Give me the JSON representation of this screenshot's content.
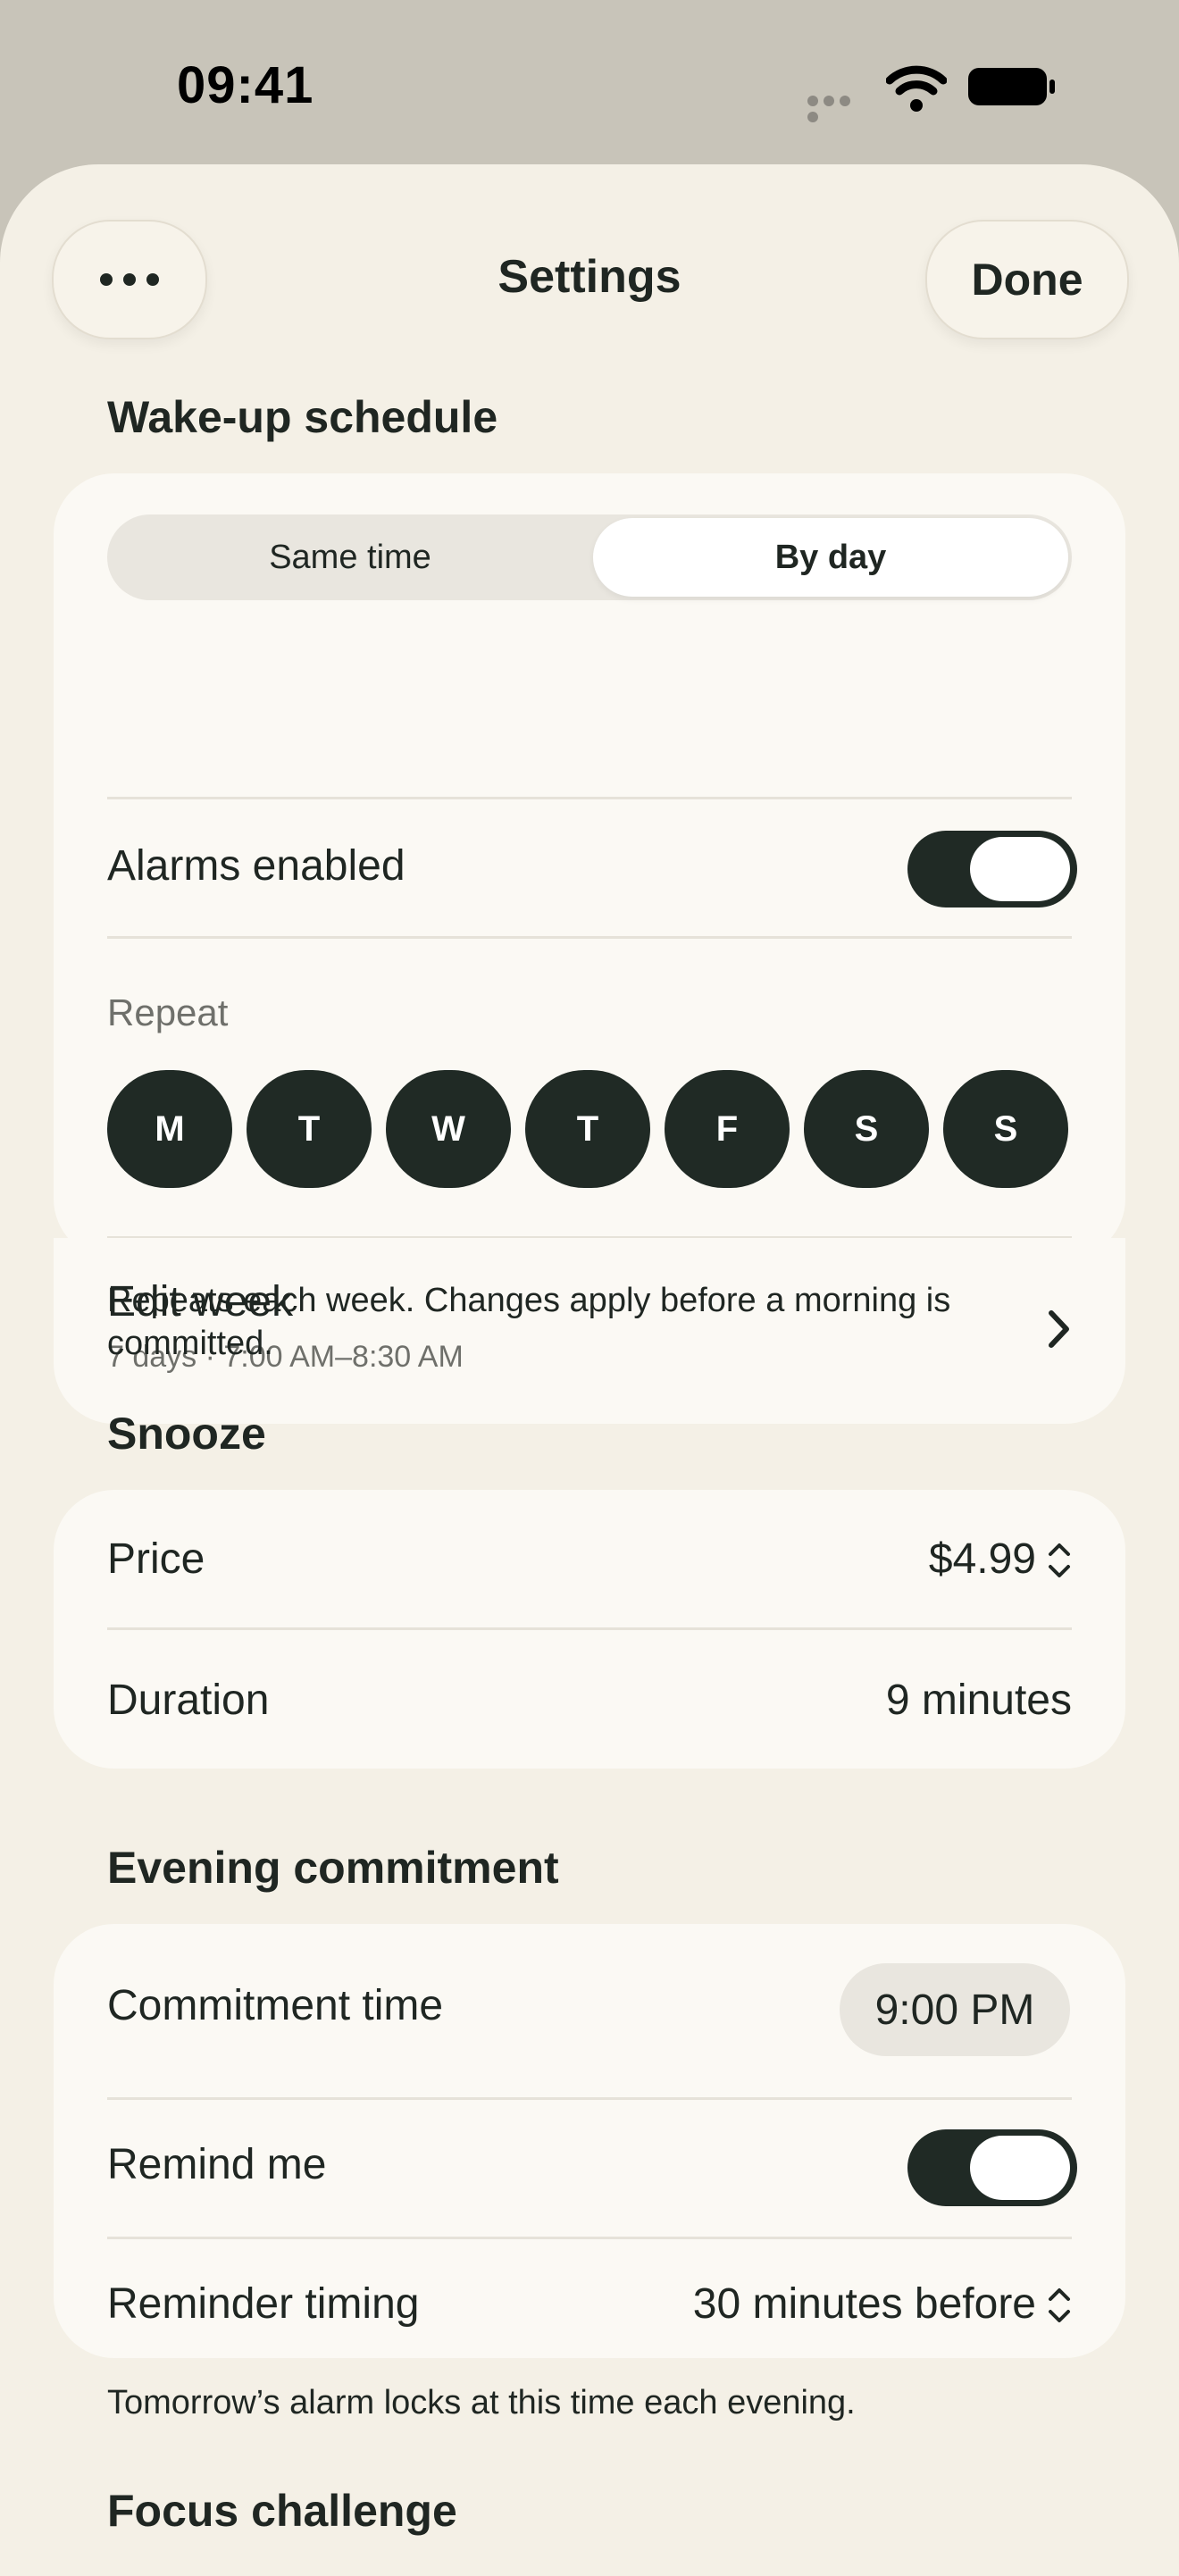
{
  "status": {
    "time": "09:41"
  },
  "nav": {
    "title": "Settings",
    "done": "Done"
  },
  "wake": {
    "heading": "Wake-up schedule",
    "segment_same": "Same time",
    "segment_by_day": "By day",
    "alarms_label": "Alarms enabled",
    "alarms_on": true,
    "repeat_label": "Repeat",
    "days": [
      "M",
      "T",
      "W",
      "T",
      "F",
      "S",
      "S"
    ],
    "edit_title": "Edit week",
    "edit_sub": "7 days · 7:00 AM–8:30 AM",
    "note": "Repeats each week. Changes apply before a morning is committed."
  },
  "snooze": {
    "heading": "Snooze",
    "price_label": "Price",
    "price_value": "$4.99",
    "duration_label": "Duration",
    "duration_value": "9 minutes"
  },
  "evening": {
    "heading": "Evening commitment",
    "time_label": "Commitment time",
    "time_value": "9:00 PM",
    "remind_label": "Remind me",
    "remind_on": true,
    "timing_label": "Reminder timing",
    "timing_value": "30 minutes before",
    "note": "Tomorrow’s alarm locks at this time each evening."
  },
  "focus": {
    "heading": "Focus challenge"
  }
}
